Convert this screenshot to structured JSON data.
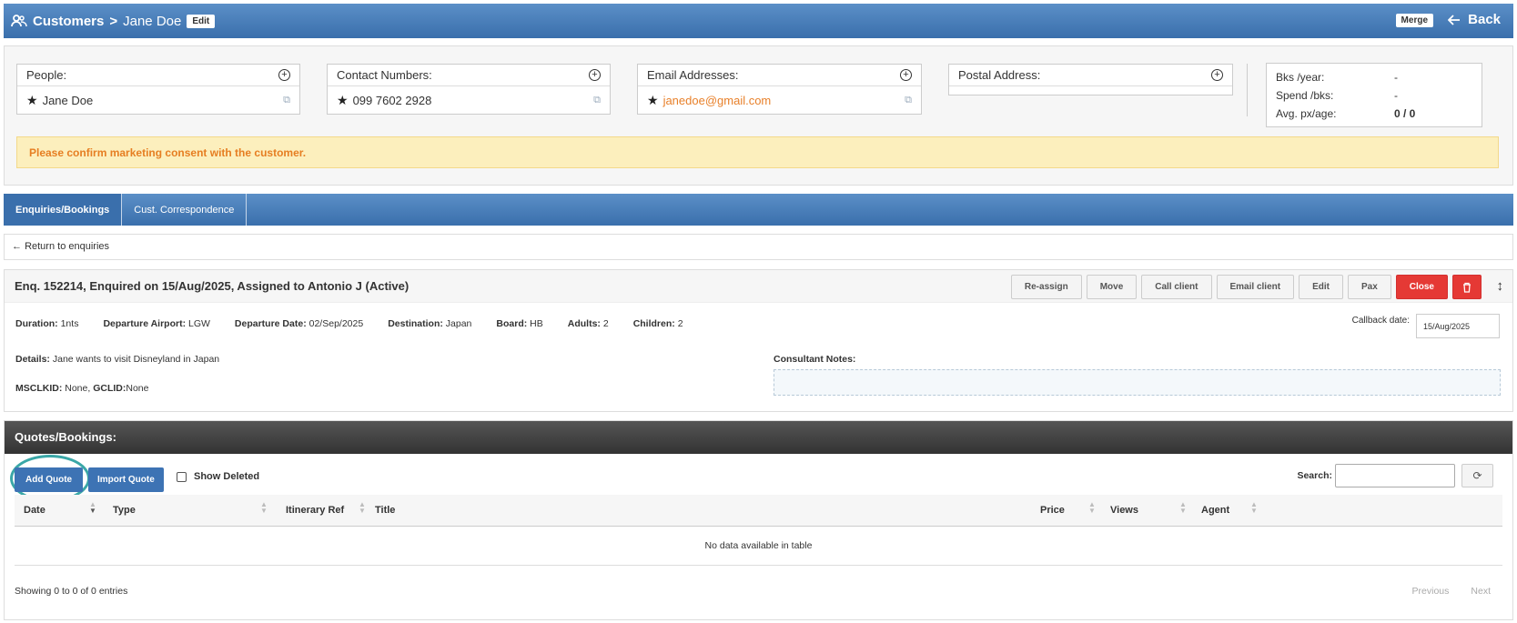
{
  "header": {
    "section": "Customers",
    "separator": ">",
    "customer_name": "Jane Doe",
    "edit_label": "Edit",
    "merge_label": "Merge",
    "back_label": "Back"
  },
  "contact": {
    "people": {
      "title": "People:",
      "value": "Jane Doe"
    },
    "phones": {
      "title": "Contact Numbers:",
      "value": "099 7602 2928"
    },
    "emails": {
      "title": "Email Addresses:",
      "value": "janedoe@gmail.com"
    },
    "postal": {
      "title": "Postal Address:"
    }
  },
  "stats": {
    "rows": [
      {
        "label": "Bks /year:",
        "value": "-"
      },
      {
        "label": "Spend /bks:",
        "value": "-"
      },
      {
        "label": "Avg. px/age:",
        "value": "0 / 0"
      }
    ]
  },
  "warning": "Please confirm marketing consent with the customer.",
  "tabs": [
    "Enquiries/Bookings",
    "Cust. Correspondence"
  ],
  "return_link": "Return to enquiries",
  "enquiry": {
    "title": "Enq. 152214, Enquired on 15/Aug/2025, Assigned to Antonio J (Active)",
    "buttons": [
      "Re-assign",
      "Move",
      "Call client",
      "Email client",
      "Edit",
      "Pax",
      "Close"
    ],
    "facts": [
      {
        "label": "Duration:",
        "value": "1nts"
      },
      {
        "label": "Departure Airport:",
        "value": "LGW"
      },
      {
        "label": "Departure Date:",
        "value": "02/Sep/2025"
      },
      {
        "label": "Destination:",
        "value": "Japan"
      },
      {
        "label": "Board:",
        "value": "HB"
      },
      {
        "label": "Adults:",
        "value": "2"
      },
      {
        "label": "Children:",
        "value": "2"
      }
    ],
    "callback_label": "Callback date:",
    "callback_value": "15/Aug/2025",
    "details_label": "Details:",
    "details_value": "Jane wants to visit Disneyland in Japan",
    "msclkid_label": "MSCLKID:",
    "msclkid_value": "None,",
    "gclid_label": "GCLID:",
    "gclid_value": "None",
    "consultant_notes_label": "Consultant Notes:"
  },
  "quotes": {
    "title": "Quotes/Bookings:",
    "add_quote": "Add Quote",
    "import_quote": "Import Quote",
    "show_deleted": "Show Deleted",
    "search_label": "Search:",
    "columns": [
      "Date",
      "Type",
      "Itinerary Ref",
      "Title",
      "Price",
      "Views",
      "Agent"
    ],
    "no_data": "No data available in table",
    "showing": "Showing 0 to 0 of 0 entries",
    "previous": "Previous",
    "next": "Next"
  }
}
